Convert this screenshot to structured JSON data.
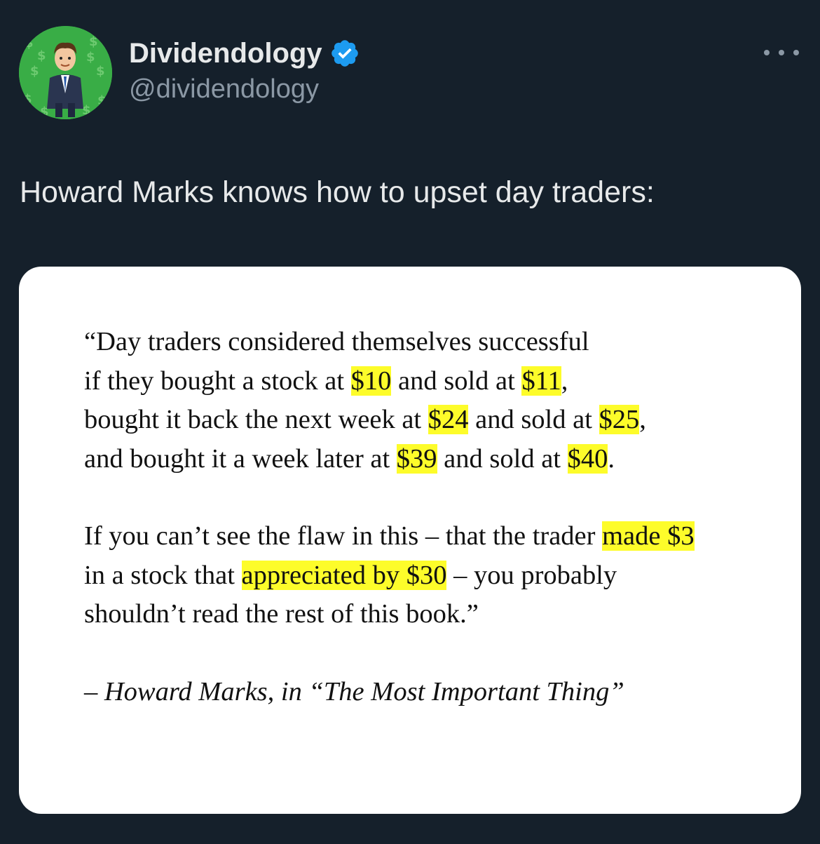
{
  "author": {
    "display_name": "Dividendology",
    "handle": "@dividendology",
    "avatar_icon": "avatar-businessman-money",
    "verified_icon": "verified-badge-icon",
    "verified_color": "#1d9bf0"
  },
  "menu": {
    "icon": "more-horizontal-icon"
  },
  "tweet": {
    "text": "Howard Marks knows how to upset day traders:"
  },
  "quote_image": {
    "highlight_color": "#fdfc2a",
    "para1": {
      "line1": {
        "a": "“Day traders considered themselves successful"
      },
      "line2": {
        "a": "if they bought a stock at ",
        "h1": "$10",
        "b": " and sold at ",
        "h2": "$11",
        "c": ","
      },
      "line3": {
        "a": "bought it back the next week at ",
        "h1": "$24",
        "b": " and sold at ",
        "h2": "$25",
        "c": ","
      },
      "line4": {
        "a": "and bought it a week later at ",
        "h1": "$39",
        "b": " and sold at ",
        "h2": "$40",
        "c": "."
      }
    },
    "para2": {
      "line1": {
        "a": "If you can’t see the flaw in this – that the trader ",
        "h1": "made $3"
      },
      "line2": {
        "a": "in a stock that ",
        "h1": "appreciated by $30",
        "b": " – you probably"
      },
      "line3": {
        "a": "shouldn’t read the rest of this book.”"
      }
    },
    "attribution": "– Howard Marks, in “The Most Important Thing”"
  }
}
